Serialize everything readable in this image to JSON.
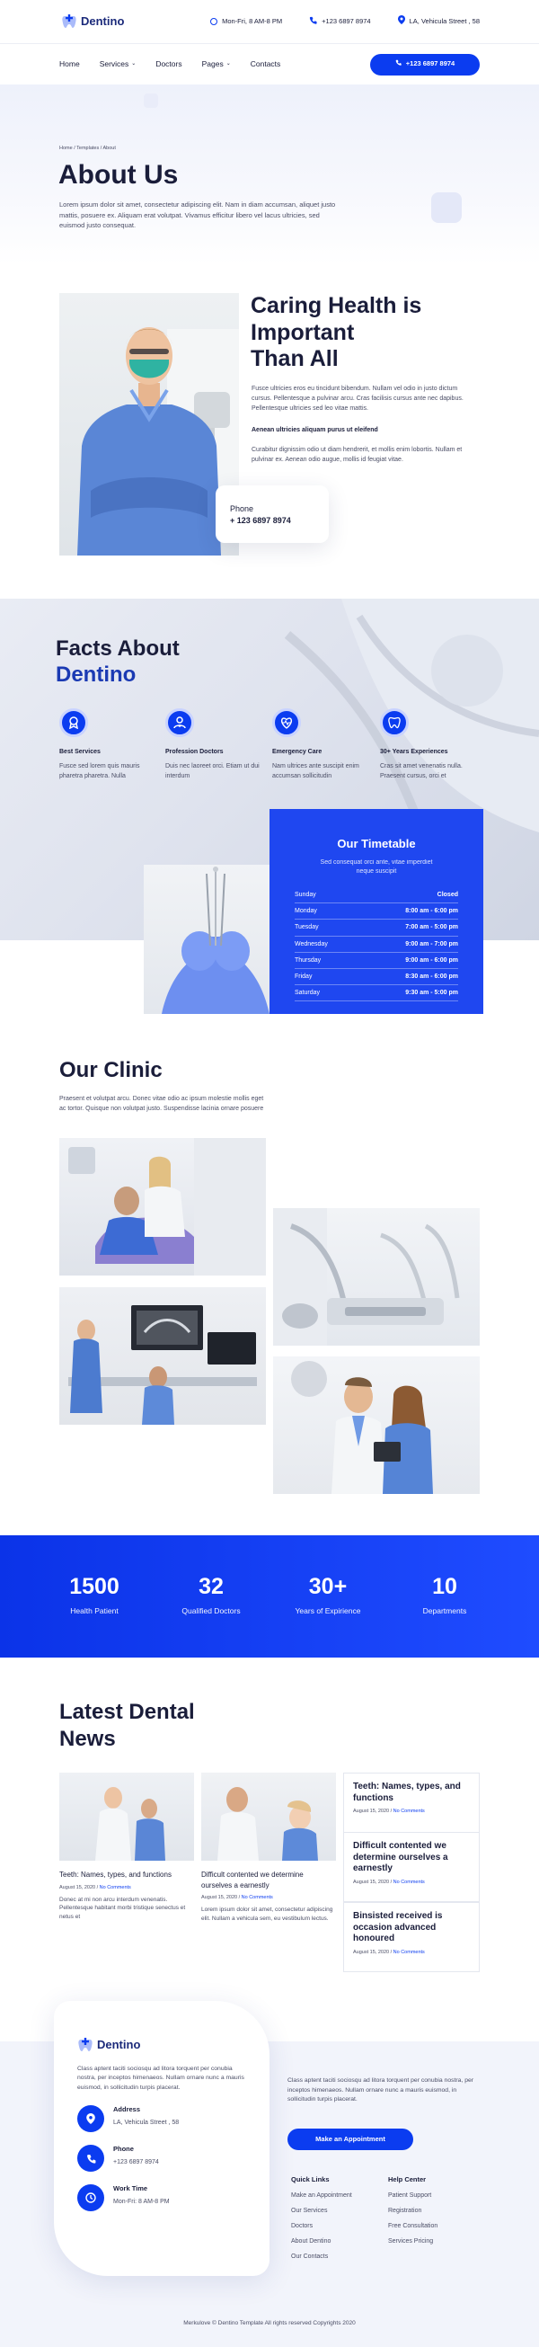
{
  "brand": {
    "name": "Dentino",
    "accent": "#0b3cf0"
  },
  "header": {
    "hours": "Mon-Fri, 8 AM-8 PM",
    "phone": "+123 6897 8974",
    "address": "LA, Vehicula Street , 58"
  },
  "nav": {
    "items": [
      "Home",
      "Services",
      "Doctors",
      "Pages",
      "Contacts"
    ],
    "cta": "+123 6897 8974"
  },
  "hero": {
    "breadcrumb": "Home / Templates / About",
    "title": "About Us",
    "text": "Lorem ipsum dolor sit amet, consectetur adipiscing elit. Nam in diam accumsan, aliquet justo mattis, posuere ex. Aliquam erat volutpat. Vivamus efficitur libero vel lacus ultricies, sed euismod justo consequat."
  },
  "caring": {
    "title_lines": [
      "Caring Health is",
      "Important",
      "Than All"
    ],
    "p1": "Fusce ultricies eros eu tincidunt bibendum. Nullam vel odio in justo dictum cursus. Pellentesque a pulvinar arcu. Cras facilisis cursus ante nec dapibus. Pellentesque ultricies sed leo vitae mattis.",
    "bold": "Aenean ultricies aliquam purus ut eleifend",
    "p2": "Curabitur dignissim odio ut diam hendrerit, et mollis enim lobortis. Nullam et pulvinar ex. Aenean odio augue, mollis id feugiat vitae.",
    "phone_label": "Phone",
    "phone_value": "+ 123 6897 8974"
  },
  "facts": {
    "title_line1": "Facts About",
    "title_line2": "Dentino",
    "items": [
      {
        "title": "Best Services",
        "text": "Fusce sed lorem quis mauris pharetra pharetra. Nulla",
        "icon": "medal-icon"
      },
      {
        "title": "Profession Doctors",
        "text": "Duis nec laoreet orci. Etiam ut dui interdum",
        "icon": "doctor-icon"
      },
      {
        "title": "Emergency Care",
        "text": "Nam ultrices ante suscipit enim accumsan sollicitudin",
        "icon": "heart-pulse-icon"
      },
      {
        "title": "30+ Years Experiences",
        "text": "Cras sit amet venenatis nulla. Praesent cursus, orci et",
        "icon": "tooth-icon"
      }
    ]
  },
  "timetable": {
    "title": "Our Timetable",
    "subtitle": "Sed consequat orci ante, vitae imperdiet neque suscipit",
    "rows": [
      {
        "day": "Sunday",
        "hours": "Closed"
      },
      {
        "day": "Monday",
        "hours": "8:00 am - 6:00 pm"
      },
      {
        "day": "Tuesday",
        "hours": "7:00 am - 5:00 pm"
      },
      {
        "day": "Wednesday",
        "hours": "9:00 am - 7:00 pm"
      },
      {
        "day": "Thursday",
        "hours": "9:00 am - 6:00 pm"
      },
      {
        "day": "Friday",
        "hours": "8:30 am - 6:00 pm"
      },
      {
        "day": "Saturday",
        "hours": "9:30 am - 5:00 pm"
      }
    ]
  },
  "clinic": {
    "title": "Our Clinic",
    "text": "Praesent et volutpat arcu. Donec vitae odio ac ipsum molestie mollis eget ac tortor. Quisque non volutpat justo. Suspendisse lacinia ornare posuere"
  },
  "stats": [
    {
      "number": "1500",
      "label": "Health Patient"
    },
    {
      "number": "32",
      "label": "Qualified Doctors"
    },
    {
      "number": "30+",
      "label": "Years of Expirience"
    },
    {
      "number": "10",
      "label": "Departments"
    }
  ],
  "news": {
    "title_line1": "Latest Dental",
    "title_line2": "News",
    "meta_date": "August 15, 2020",
    "meta_comments": "No Comments",
    "cards": [
      {
        "title": "Teeth: Names, types, and functions",
        "text": "Donec at mi non arcu interdum venenatis. Pellentesque habitant morbi tristique senectus et netus et"
      },
      {
        "title": "Difficult contented we determine ourselves a earnestly",
        "text": "Lorem ipsum dolor sit amet, consectetur adipiscing elit. Nullam a vehicula sem, eu vestibulum lectus."
      }
    ],
    "side": [
      {
        "title": "Teeth: Names, types, and functions"
      },
      {
        "title": "Difficult contented we determine ourselves a earnestly"
      },
      {
        "title": "Binsisted received is occasion advanced honoured"
      }
    ]
  },
  "footer": {
    "about": "Class aptent taciti sociosqu ad litora torquent per conubia nostra, per inceptos himenaeos. Nullam ornare nunc a mauris euismod, in sollicitudin turpis placerat.",
    "address_label": "Address",
    "address": "LA, Vehicula Street , 58",
    "phone_label": "Phone",
    "phone": "+123 6897 8974",
    "work_label": "Work Time",
    "work": "Mon-Fri: 8 AM-8 PM",
    "right_text": "Class aptent taciti sociosqu ad litora torquent per conubia nostra, per inceptos himenaeos. Nullam ornare nunc a mauris euismod, in sollicitudin turpis placerat.",
    "cta": "Make an Appointment",
    "quick_title": "Quick Links",
    "quick": [
      "Make an Appointment",
      "Our Services",
      "Doctors",
      "About Dentino",
      "Our Contacts"
    ],
    "help_title": "Help Center",
    "help": [
      "Patient Support",
      "Registration",
      "Free Consultation",
      "Services Pricing"
    ],
    "copyright": "Merkulove © Dentino Template All rights reserved Copyrights 2020"
  }
}
